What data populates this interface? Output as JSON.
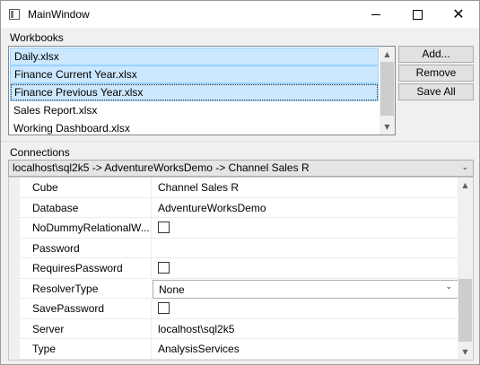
{
  "window": {
    "title": "MainWindow"
  },
  "workbooks": {
    "label": "Workbooks",
    "items": [
      {
        "label": "Daily.xlsx"
      },
      {
        "label": "Finance Current Year.xlsx"
      },
      {
        "label": "Finance Previous Year.xlsx"
      },
      {
        "label": "Sales Report.xlsx"
      },
      {
        "label": "Working Dashboard.xlsx"
      }
    ],
    "selected": [
      "Daily.xlsx",
      "Finance Current Year.xlsx",
      "Finance Previous Year.xlsx"
    ],
    "focused": "Finance Previous Year.xlsx",
    "buttons": {
      "add": "Add...",
      "remove": "Remove",
      "save_all": "Save All"
    }
  },
  "connections": {
    "label": "Connections",
    "selected": "localhost\\sql2k5 -> AdventureWorksDemo -> Channel Sales R",
    "properties": [
      {
        "name": "Cube",
        "value": "Channel Sales R"
      },
      {
        "name": "Database",
        "value": "AdventureWorksDemo"
      },
      {
        "name": "NoDummyRelationalW...",
        "value": ""
      },
      {
        "name": "Password",
        "value": ""
      },
      {
        "name": "RequiresPassword",
        "value": ""
      },
      {
        "name": "ResolverType",
        "value": "None"
      },
      {
        "name": "SavePassword",
        "value": ""
      },
      {
        "name": "Server",
        "value": "localhost\\sql2k5"
      },
      {
        "name": "Type",
        "value": "AnalysisServices"
      }
    ]
  },
  "icons": {
    "app": "window-app-icon",
    "minimize": "minimize-icon",
    "maximize": "maximize-icon",
    "close": "close-icon",
    "scroll_up": "scroll-up-arrow-icon",
    "scroll_down": "scroll-down-arrow-icon",
    "dropdown": "chevron-down-icon"
  },
  "colors": {
    "selection": "#cce8ff",
    "selection_border": "#99d1ff",
    "button": "#e1e1e1"
  }
}
